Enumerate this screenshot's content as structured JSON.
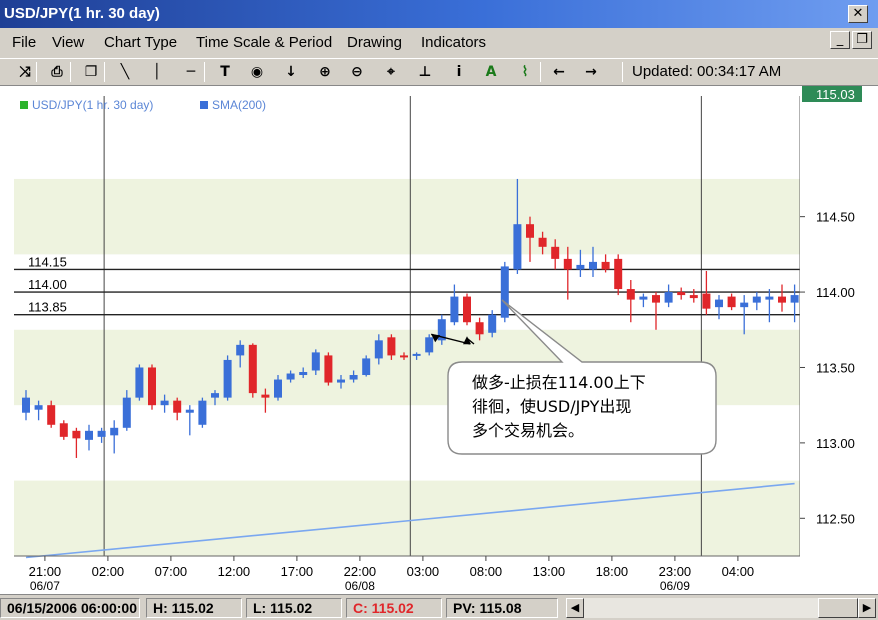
{
  "window": {
    "title": "USD/JPY(1 hr.  30 day)",
    "close_glyph": "✕",
    "restore_glyph": "❐",
    "minimize_glyph": "_"
  },
  "menu": [
    "File",
    "View",
    "Chart Type",
    "Time Scale & Period",
    "Drawing",
    "Indicators"
  ],
  "toolbar": {
    "tools": [
      {
        "name": "cursor-cross-icon",
        "glyph": "⤨"
      },
      {
        "name": "print-icon",
        "glyph": "⎙"
      },
      {
        "name": "copy-icon",
        "glyph": "❐"
      },
      {
        "name": "line-tool-icon",
        "glyph": "╲"
      },
      {
        "name": "vertical-line-icon",
        "glyph": "│"
      },
      {
        "name": "horizontal-line-icon",
        "glyph": "─"
      },
      {
        "name": "text-tool-icon",
        "glyph": "T"
      },
      {
        "name": "target-icon",
        "glyph": "◉"
      },
      {
        "name": "arrow-down-icon",
        "glyph": "↓"
      },
      {
        "name": "zoom-in-icon",
        "glyph": "⊕"
      },
      {
        "name": "zoom-out-icon",
        "glyph": "⊖"
      },
      {
        "name": "fit-icon",
        "glyph": "⌖"
      },
      {
        "name": "anchor-icon",
        "glyph": "⊥"
      },
      {
        "name": "info-icon",
        "glyph": "i"
      },
      {
        "name": "annotation-a-icon",
        "glyph": "A"
      },
      {
        "name": "trend-icon",
        "glyph": "⌇"
      },
      {
        "name": "scroll-left-icon",
        "glyph": "←"
      },
      {
        "name": "scroll-right-icon",
        "glyph": "→"
      }
    ],
    "updated": "Updated: 00:34:17 AM"
  },
  "chart_data": {
    "type": "candlestick",
    "legend": [
      {
        "label": "USD/JPY(1 hr.  30 day)",
        "color": "#2db32d"
      },
      {
        "label": "SMA(200)",
        "color": "#3a6fd8"
      }
    ],
    "current_price": "115.03",
    "ylim": [
      112.25,
      115.3
    ],
    "y_ticks": [
      {
        "value": 114.5,
        "label": "114.50"
      },
      {
        "value": 114.0,
        "label": "114.00"
      },
      {
        "value": 113.5,
        "label": "113.50"
      },
      {
        "value": 113.0,
        "label": "113.00"
      },
      {
        "value": 112.5,
        "label": "112.50"
      }
    ],
    "x_ticks": [
      {
        "i": 1.5,
        "label": "21:00",
        "sub": "06/07"
      },
      {
        "i": 6.5,
        "label": "02:00",
        "sub": ""
      },
      {
        "i": 11.5,
        "label": "07:00",
        "sub": ""
      },
      {
        "i": 16.5,
        "label": "12:00",
        "sub": ""
      },
      {
        "i": 21.5,
        "label": "17:00",
        "sub": ""
      },
      {
        "i": 26.5,
        "label": "22:00",
        "sub": "06/08"
      },
      {
        "i": 31.5,
        "label": "03:00",
        "sub": ""
      },
      {
        "i": 36.5,
        "label": "08:00",
        "sub": ""
      },
      {
        "i": 41.5,
        "label": "13:00",
        "sub": ""
      },
      {
        "i": 46.5,
        "label": "18:00",
        "sub": ""
      },
      {
        "i": 51.5,
        "label": "23:00",
        "sub": "06/09"
      },
      {
        "i": 56.5,
        "label": "04:00",
        "sub": ""
      }
    ],
    "day_separators": [
      6.2,
      30.5,
      53.6
    ],
    "hlines": [
      {
        "value": 114.15,
        "label": "114.15"
      },
      {
        "value": 114.0,
        "label": "114.00"
      },
      {
        "value": 113.85,
        "label": "113.85"
      }
    ],
    "candles": [
      {
        "o": 113.2,
        "h": 113.35,
        "l": 113.15,
        "c": 113.3
      },
      {
        "o": 113.22,
        "h": 113.28,
        "l": 113.15,
        "c": 113.25
      },
      {
        "o": 113.25,
        "h": 113.28,
        "l": 113.1,
        "c": 113.12
      },
      {
        "o": 113.13,
        "h": 113.15,
        "l": 113.02,
        "c": 113.04
      },
      {
        "o": 113.08,
        "h": 113.1,
        "l": 112.9,
        "c": 113.03
      },
      {
        "o": 113.02,
        "h": 113.12,
        "l": 112.95,
        "c": 113.08
      },
      {
        "o": 113.04,
        "h": 113.1,
        "l": 113.0,
        "c": 113.08
      },
      {
        "o": 113.05,
        "h": 113.15,
        "l": 112.93,
        "c": 113.1
      },
      {
        "o": 113.1,
        "h": 113.35,
        "l": 113.08,
        "c": 113.3
      },
      {
        "o": 113.3,
        "h": 113.52,
        "l": 113.28,
        "c": 113.5
      },
      {
        "o": 113.5,
        "h": 113.52,
        "l": 113.22,
        "c": 113.25
      },
      {
        "o": 113.25,
        "h": 113.32,
        "l": 113.2,
        "c": 113.28
      },
      {
        "o": 113.28,
        "h": 113.3,
        "l": 113.15,
        "c": 113.2
      },
      {
        "o": 113.2,
        "h": 113.25,
        "l": 113.05,
        "c": 113.22
      },
      {
        "o": 113.12,
        "h": 113.3,
        "l": 113.1,
        "c": 113.28
      },
      {
        "o": 113.3,
        "h": 113.35,
        "l": 113.25,
        "c": 113.33
      },
      {
        "o": 113.3,
        "h": 113.58,
        "l": 113.28,
        "c": 113.55
      },
      {
        "o": 113.58,
        "h": 113.68,
        "l": 113.5,
        "c": 113.65
      },
      {
        "o": 113.65,
        "h": 113.66,
        "l": 113.3,
        "c": 113.33
      },
      {
        "o": 113.32,
        "h": 113.36,
        "l": 113.2,
        "c": 113.3
      },
      {
        "o": 113.3,
        "h": 113.45,
        "l": 113.28,
        "c": 113.42
      },
      {
        "o": 113.42,
        "h": 113.48,
        "l": 113.4,
        "c": 113.46
      },
      {
        "o": 113.45,
        "h": 113.5,
        "l": 113.43,
        "c": 113.47
      },
      {
        "o": 113.48,
        "h": 113.62,
        "l": 113.45,
        "c": 113.6
      },
      {
        "o": 113.58,
        "h": 113.6,
        "l": 113.38,
        "c": 113.4
      },
      {
        "o": 113.4,
        "h": 113.45,
        "l": 113.36,
        "c": 113.42
      },
      {
        "o": 113.42,
        "h": 113.48,
        "l": 113.4,
        "c": 113.45
      },
      {
        "o": 113.45,
        "h": 113.58,
        "l": 113.44,
        "c": 113.56
      },
      {
        "o": 113.56,
        "h": 113.72,
        "l": 113.52,
        "c": 113.68
      },
      {
        "o": 113.7,
        "h": 113.72,
        "l": 113.55,
        "c": 113.58
      },
      {
        "o": 113.58,
        "h": 113.6,
        "l": 113.55,
        "c": 113.57
      },
      {
        "o": 113.58,
        "h": 113.6,
        "l": 113.55,
        "c": 113.59
      },
      {
        "o": 113.6,
        "h": 113.72,
        "l": 113.58,
        "c": 113.7
      },
      {
        "o": 113.68,
        "h": 113.85,
        "l": 113.65,
        "c": 113.82
      },
      {
        "o": 113.8,
        "h": 114.05,
        "l": 113.78,
        "c": 113.97
      },
      {
        "o": 113.97,
        "h": 113.99,
        "l": 113.78,
        "c": 113.8
      },
      {
        "o": 113.8,
        "h": 113.83,
        "l": 113.68,
        "c": 113.72
      },
      {
        "o": 113.73,
        "h": 113.88,
        "l": 113.7,
        "c": 113.85
      },
      {
        "o": 113.83,
        "h": 114.2,
        "l": 113.8,
        "c": 114.17
      },
      {
        "o": 114.15,
        "h": 114.75,
        "l": 114.12,
        "c": 114.45
      },
      {
        "o": 114.45,
        "h": 114.5,
        "l": 114.2,
        "c": 114.36
      },
      {
        "o": 114.36,
        "h": 114.4,
        "l": 114.25,
        "c": 114.3
      },
      {
        "o": 114.3,
        "h": 114.35,
        "l": 114.15,
        "c": 114.22
      },
      {
        "o": 114.22,
        "h": 114.3,
        "l": 113.95,
        "c": 114.15
      },
      {
        "o": 114.15,
        "h": 114.28,
        "l": 114.1,
        "c": 114.18
      },
      {
        "o": 114.15,
        "h": 114.3,
        "l": 114.1,
        "c": 114.2
      },
      {
        "o": 114.2,
        "h": 114.25,
        "l": 114.13,
        "c": 114.15
      },
      {
        "o": 114.22,
        "h": 114.25,
        "l": 113.98,
        "c": 114.02
      },
      {
        "o": 114.02,
        "h": 114.08,
        "l": 113.8,
        "c": 113.95
      },
      {
        "o": 113.95,
        "h": 113.99,
        "l": 113.9,
        "c": 113.97
      },
      {
        "o": 113.98,
        "h": 114.0,
        "l": 113.75,
        "c": 113.93
      },
      {
        "o": 113.93,
        "h": 114.05,
        "l": 113.9,
        "c": 114.0
      },
      {
        "o": 114.0,
        "h": 114.03,
        "l": 113.95,
        "c": 113.98
      },
      {
        "o": 113.98,
        "h": 114.02,
        "l": 113.93,
        "c": 113.96
      },
      {
        "o": 113.99,
        "h": 114.14,
        "l": 113.85,
        "c": 113.89
      },
      {
        "o": 113.9,
        "h": 113.98,
        "l": 113.82,
        "c": 113.95
      },
      {
        "o": 113.97,
        "h": 113.99,
        "l": 113.88,
        "c": 113.9
      },
      {
        "o": 113.9,
        "h": 113.98,
        "l": 113.72,
        "c": 113.93
      },
      {
        "o": 113.93,
        "h": 114.0,
        "l": 113.88,
        "c": 113.97
      },
      {
        "o": 113.95,
        "h": 114.02,
        "l": 113.8,
        "c": 113.97
      },
      {
        "o": 113.97,
        "h": 114.05,
        "l": 113.87,
        "c": 113.93
      },
      {
        "o": 113.93,
        "h": 114.05,
        "l": 113.8,
        "c": 113.98
      }
    ],
    "sma200": {
      "start": 112.24,
      "end": 112.73
    },
    "callout": {
      "lines": [
        "做多-止损在114.00上下",
        "徘徊，使USD/JPY出现",
        "多个交易机会。"
      ]
    }
  },
  "status": {
    "date": "06/15/2006 06:00:00",
    "high": "H: 115.02",
    "low": "L: 115.02",
    "close": "C: 115.02",
    "pv": "PV: 115.08",
    "scroll_left": "◀",
    "scroll_right": "▶"
  },
  "colors": {
    "up": "#3a6fd8",
    "down": "#e0262a",
    "band": "#eef3df",
    "price_tag": "#2e8b57"
  }
}
